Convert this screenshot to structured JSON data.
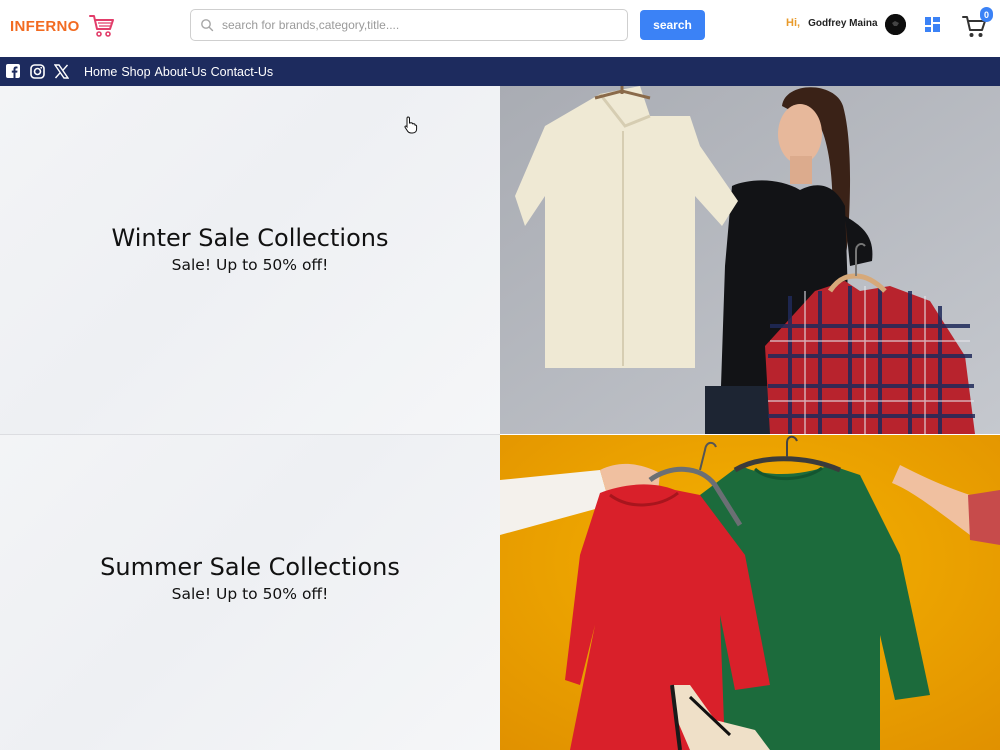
{
  "header": {
    "brand": "INFERNO",
    "brand_color": "#f26b21",
    "search": {
      "placeholder": "search for brands,category,title....",
      "value": "",
      "button_label": "search"
    },
    "user": {
      "greeting": "Hi,",
      "name": "Godfrey Maina"
    },
    "cart_count": "0",
    "accent": "#3b82f6"
  },
  "nav": {
    "social": [
      "facebook-icon",
      "instagram-icon",
      "x-icon"
    ],
    "links": [
      "Home",
      "Shop",
      "About-Us",
      "Contact-Us"
    ],
    "background": "#1d2b5e"
  },
  "banners": [
    {
      "title": "Winter Sale Collections",
      "subtitle": "Sale! Up to 50% off!",
      "image": "woman-holding-shirts-photo"
    },
    {
      "title": "Summer Sale Collections",
      "subtitle": "Sale! Up to 50% off!",
      "image": "hands-holding-dresses-photo"
    }
  ]
}
